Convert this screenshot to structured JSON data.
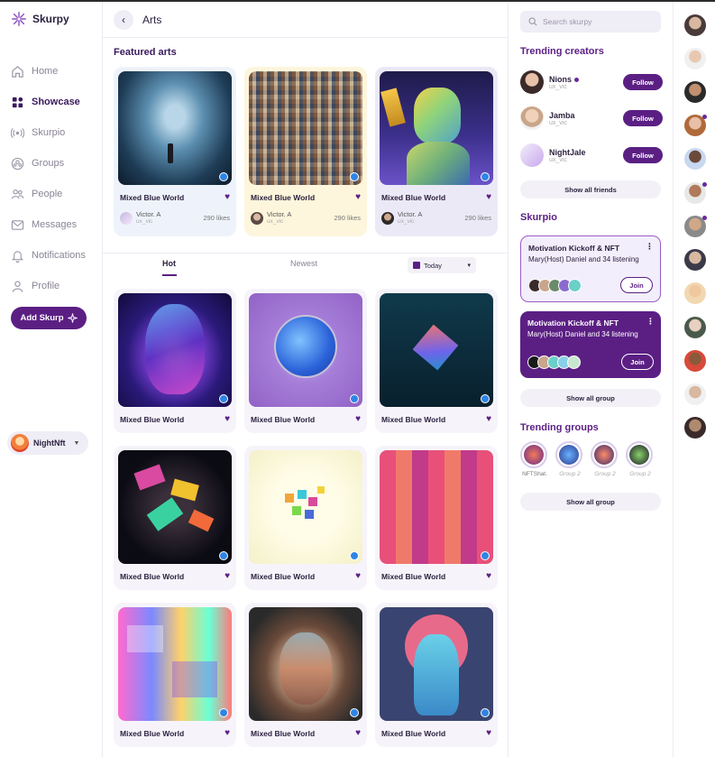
{
  "app": {
    "name": "Skurpy"
  },
  "sidebar": {
    "items": [
      {
        "label": "Home",
        "icon": "home-icon",
        "active": false
      },
      {
        "label": "Showcase",
        "icon": "showcase-icon",
        "active": true
      },
      {
        "label": "Skurpio",
        "icon": "broadcast-icon",
        "active": false
      },
      {
        "label": "Groups",
        "icon": "groups-icon",
        "active": false
      },
      {
        "label": "People",
        "icon": "people-icon",
        "active": false
      },
      {
        "label": "Messages",
        "icon": "mail-icon",
        "active": false
      },
      {
        "label": "Notifications",
        "icon": "bell-icon",
        "active": false
      },
      {
        "label": "Profile",
        "icon": "user-icon",
        "active": false
      }
    ],
    "add_button": "Add Skurp",
    "user": {
      "name": "NightNft"
    }
  },
  "header": {
    "title": "Arts"
  },
  "featured": {
    "title": "Featured arts",
    "cards": [
      {
        "title": "Mixed Blue World",
        "author": "Victor. A",
        "handle": "ux_vic",
        "likes": "290 likes"
      },
      {
        "title": "Mixed Blue World",
        "author": "Victor. A",
        "handle": "ux_vic",
        "likes": "290 likes"
      },
      {
        "title": "Mixed Blue World",
        "author": "Victor. A",
        "handle": "ux_vic",
        "likes": "290 likes"
      }
    ]
  },
  "tabs": {
    "hot": "Hot",
    "newest": "Newest",
    "filter": "Today"
  },
  "grid": [
    "Mixed Blue World",
    "Mixed Blue World",
    "Mixed Blue World",
    "Mixed Blue World",
    "Mixed Blue World",
    "Mixed Blue World",
    "Mixed Blue World",
    "Mixed Blue World",
    "Mixed Blue World"
  ],
  "right": {
    "search_placeholder": "Search skurpy",
    "trending_creators_title": "Trending creators",
    "creators": [
      {
        "name": "Nions",
        "handle": "ux_vic",
        "follow": "Follow",
        "online": true
      },
      {
        "name": "Jamba",
        "handle": "ux_vic",
        "follow": "Follow",
        "online": false
      },
      {
        "name": "NightJale",
        "handle": "ux_vic",
        "follow": "Follow",
        "online": false
      }
    ],
    "show_all_friends": "Show all friends",
    "skurpio_title": "Skurpio",
    "skurpio_cards": [
      {
        "title": "Motivation Kickoff & NFT",
        "subtitle": "Mary(Host) Daniel and 34 listening",
        "join": "Join"
      },
      {
        "title": "Motivation Kickoff & NFT",
        "subtitle": "Mary(Host) Daniel and 34 listening",
        "join": "Join"
      }
    ],
    "show_all_group_1": "Show all group",
    "trending_groups_title": "Trending groups",
    "groups": [
      "NFTShat.",
      "Group 2",
      "Group 2",
      "Group 2"
    ],
    "show_all_group_2": "Show all group"
  },
  "colors": {
    "accent": "#5b1f84",
    "accent_light": "#f3eefb",
    "download_badge": "#2f84e6"
  }
}
